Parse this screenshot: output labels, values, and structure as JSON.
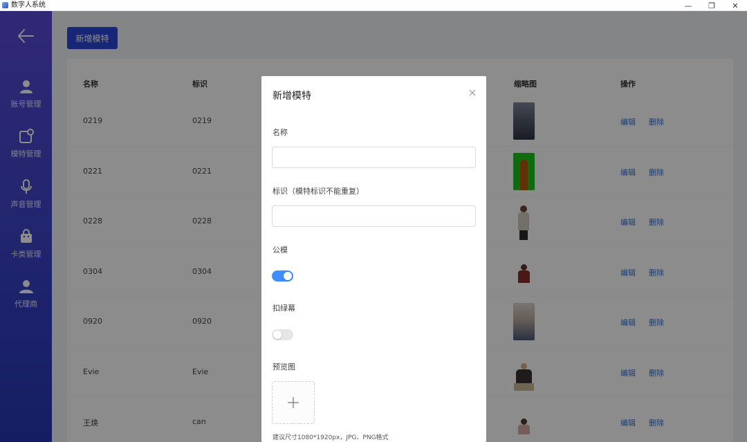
{
  "window": {
    "title": "数字人系统",
    "controls": {
      "minimize": "—",
      "restore": "❐",
      "close": "✕"
    }
  },
  "sidebar": {
    "back_icon": "arrow-left-icon",
    "items": [
      {
        "label": "账号管理",
        "icon": "user-icon"
      },
      {
        "label": "模特管理",
        "icon": "model-icon"
      },
      {
        "label": "声音管理",
        "icon": "microphone-icon"
      },
      {
        "label": "卡类管理",
        "icon": "bag-icon"
      },
      {
        "label": "代理商",
        "icon": "agent-icon"
      }
    ]
  },
  "toolbar": {
    "add_label": "新增模特"
  },
  "table": {
    "headers": {
      "name": "名称",
      "id": "标识",
      "thumb": "缩略图",
      "ops": "操作"
    },
    "rows": [
      {
        "name": "0219",
        "id": "0219",
        "edit": "编辑",
        "delete": "删除"
      },
      {
        "name": "0221",
        "id": "0221",
        "edit": "编辑",
        "delete": "删除"
      },
      {
        "name": "0228",
        "id": "0228",
        "edit": "编辑",
        "delete": "删除"
      },
      {
        "name": "0304",
        "id": "0304",
        "edit": "编辑",
        "delete": "删除"
      },
      {
        "name": "0920",
        "id": "0920",
        "edit": "编辑",
        "delete": "删除"
      },
      {
        "name": "Evie",
        "id": "Evie",
        "edit": "编辑",
        "delete": "删除"
      },
      {
        "name": "王焕",
        "id": "can",
        "edit": "编辑",
        "delete": "删除"
      }
    ]
  },
  "dialog": {
    "title": "新增模特",
    "fields": {
      "name_label": "名称",
      "name_value": "",
      "id_label": "标识（模特标识不能重复）",
      "id_value": "",
      "public_label": "公模",
      "public_on": true,
      "greenscreen_label": "扣绿幕",
      "greenscreen_on": false,
      "preview_label": "预览图",
      "upload_hint": "建议尺寸1080*1920px，JPG、PNG格式"
    }
  }
}
